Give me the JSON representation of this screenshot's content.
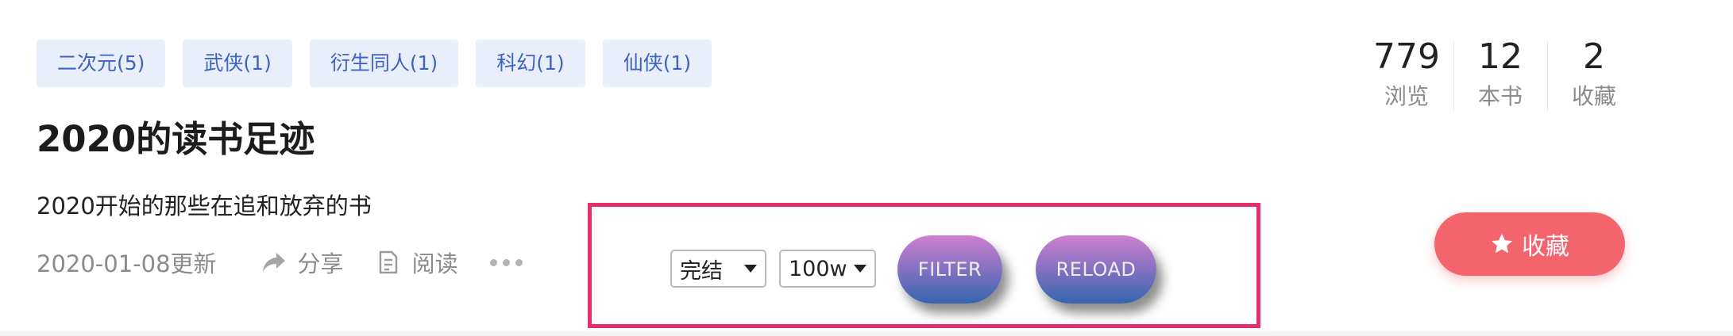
{
  "tags": [
    "二次元(5)",
    "武侠(1)",
    "衍生同人(1)",
    "科幻(1)",
    "仙侠(1)"
  ],
  "title": "2020的读书足迹",
  "description": "2020开始的那些在追和放弃的书",
  "meta": {
    "updated": "2020-01-08更新",
    "share_label": "分享",
    "read_label": "阅读",
    "share_icon": "share-arrow-icon",
    "read_icon": "document-icon",
    "more_icon": "more-dots-icon"
  },
  "stats": [
    {
      "value": "779",
      "label": "浏览"
    },
    {
      "value": "12",
      "label": "本书"
    },
    {
      "value": "2",
      "label": "收藏"
    }
  ],
  "favorite_button": {
    "label": "收藏",
    "icon": "star-icon",
    "color": "#f4646d"
  },
  "filter_panel": {
    "status_select": {
      "selected": "完结"
    },
    "words_select": {
      "selected": "100w"
    },
    "filter_button": "FILTER",
    "reload_button": "RELOAD",
    "border_color": "#e62e6b"
  },
  "colors": {
    "tag_bg": "#e9effa",
    "tag_text": "#3d62c4"
  }
}
